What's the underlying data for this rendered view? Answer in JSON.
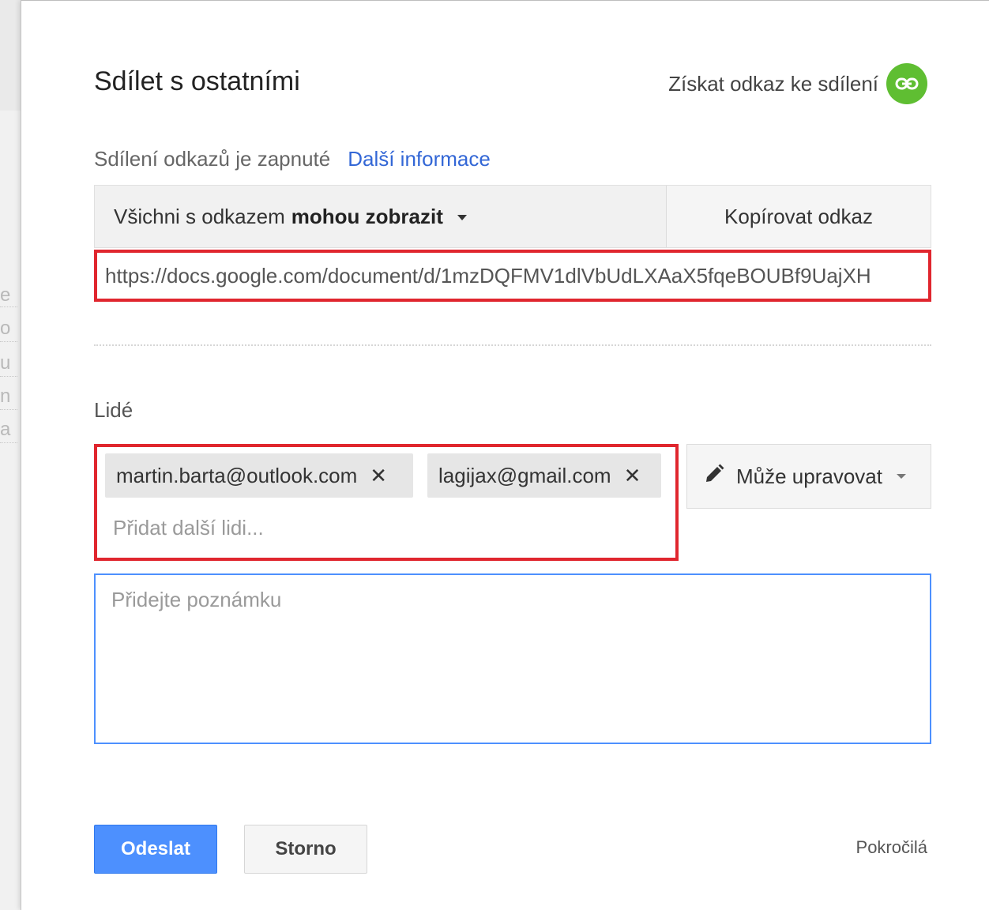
{
  "dialog": {
    "title": "Sdílet s ostatními",
    "get_link_label": "Získat odkaz ke sdílení",
    "get_link_icon": "link-icon",
    "accent_color": "#5fbe32"
  },
  "link_sharing": {
    "status_text": "Sdílení odkazů je zapnuté",
    "more_info_label": "Další informace",
    "permission_prefix": "Všichni s odkazem",
    "permission_value": "mohou zobrazit",
    "copy_label": "Kopírovat odkaz",
    "url": "https://docs.google.com/document/d/1mzDQFMV1dlVbUdLXAaX5fqeBOUBf9UajXH"
  },
  "people": {
    "label": "Lidé",
    "chips": [
      {
        "email": "martin.barta@outlook.com",
        "remove_icon": "close-icon"
      },
      {
        "email": "lagijax@gmail.com",
        "remove_icon": "close-icon"
      }
    ],
    "add_placeholder": "Přidat další lidi...",
    "role_label": "Může upravovat",
    "role_icon": "pencil-icon"
  },
  "note": {
    "placeholder": "Přidejte poznámku"
  },
  "footer": {
    "send_label": "Odeslat",
    "cancel_label": "Storno",
    "advanced_label": "Pokročilá",
    "primary_color": "#4d90fe"
  },
  "background_doc": {
    "letters": [
      "e",
      "o",
      "u",
      "n",
      "a"
    ]
  }
}
